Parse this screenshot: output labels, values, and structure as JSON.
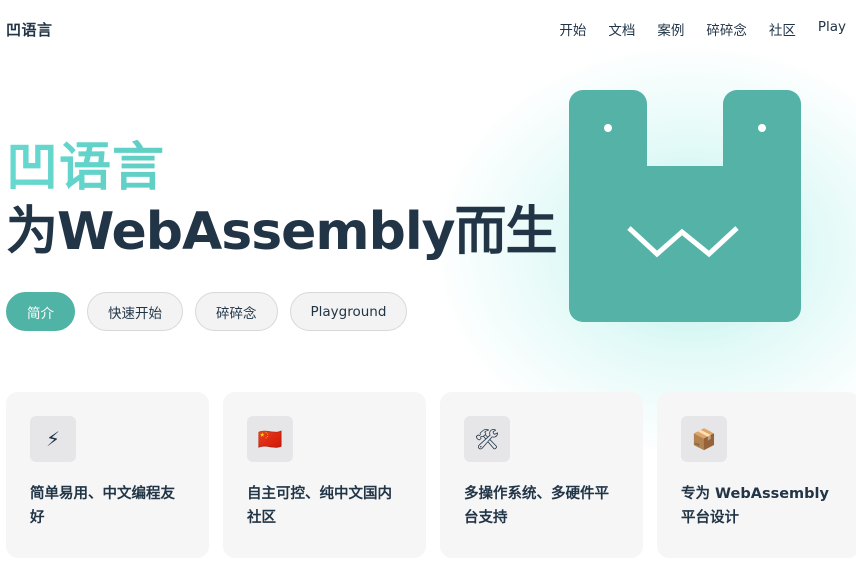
{
  "nav": {
    "logo": "凹语言",
    "links": [
      "开始",
      "文档",
      "案例",
      "碎碎念",
      "社区",
      "Play"
    ]
  },
  "hero": {
    "name": "凹语言",
    "tagline": "为WebAssembly而生",
    "actions": [
      "简介",
      "快速开始",
      "碎碎念",
      "Playground"
    ]
  },
  "features": [
    {
      "icon": "⚡",
      "icon_name": "lightning-icon",
      "text": "简单易用、中文编程友好"
    },
    {
      "icon": "🇨🇳",
      "icon_name": "china-flag-icon",
      "text": "自主可控、纯中文国内社区"
    },
    {
      "icon": "🛠",
      "icon_name": "tools-icon",
      "text": "多操作系统、多硬件平台支持"
    },
    {
      "icon": "📦",
      "icon_name": "package-icon",
      "text": "专为 WebAssembly 平台设计"
    }
  ],
  "colors": {
    "brand": "#4fb3a5",
    "brand_light": "#66d9d0",
    "text": "#213547"
  }
}
